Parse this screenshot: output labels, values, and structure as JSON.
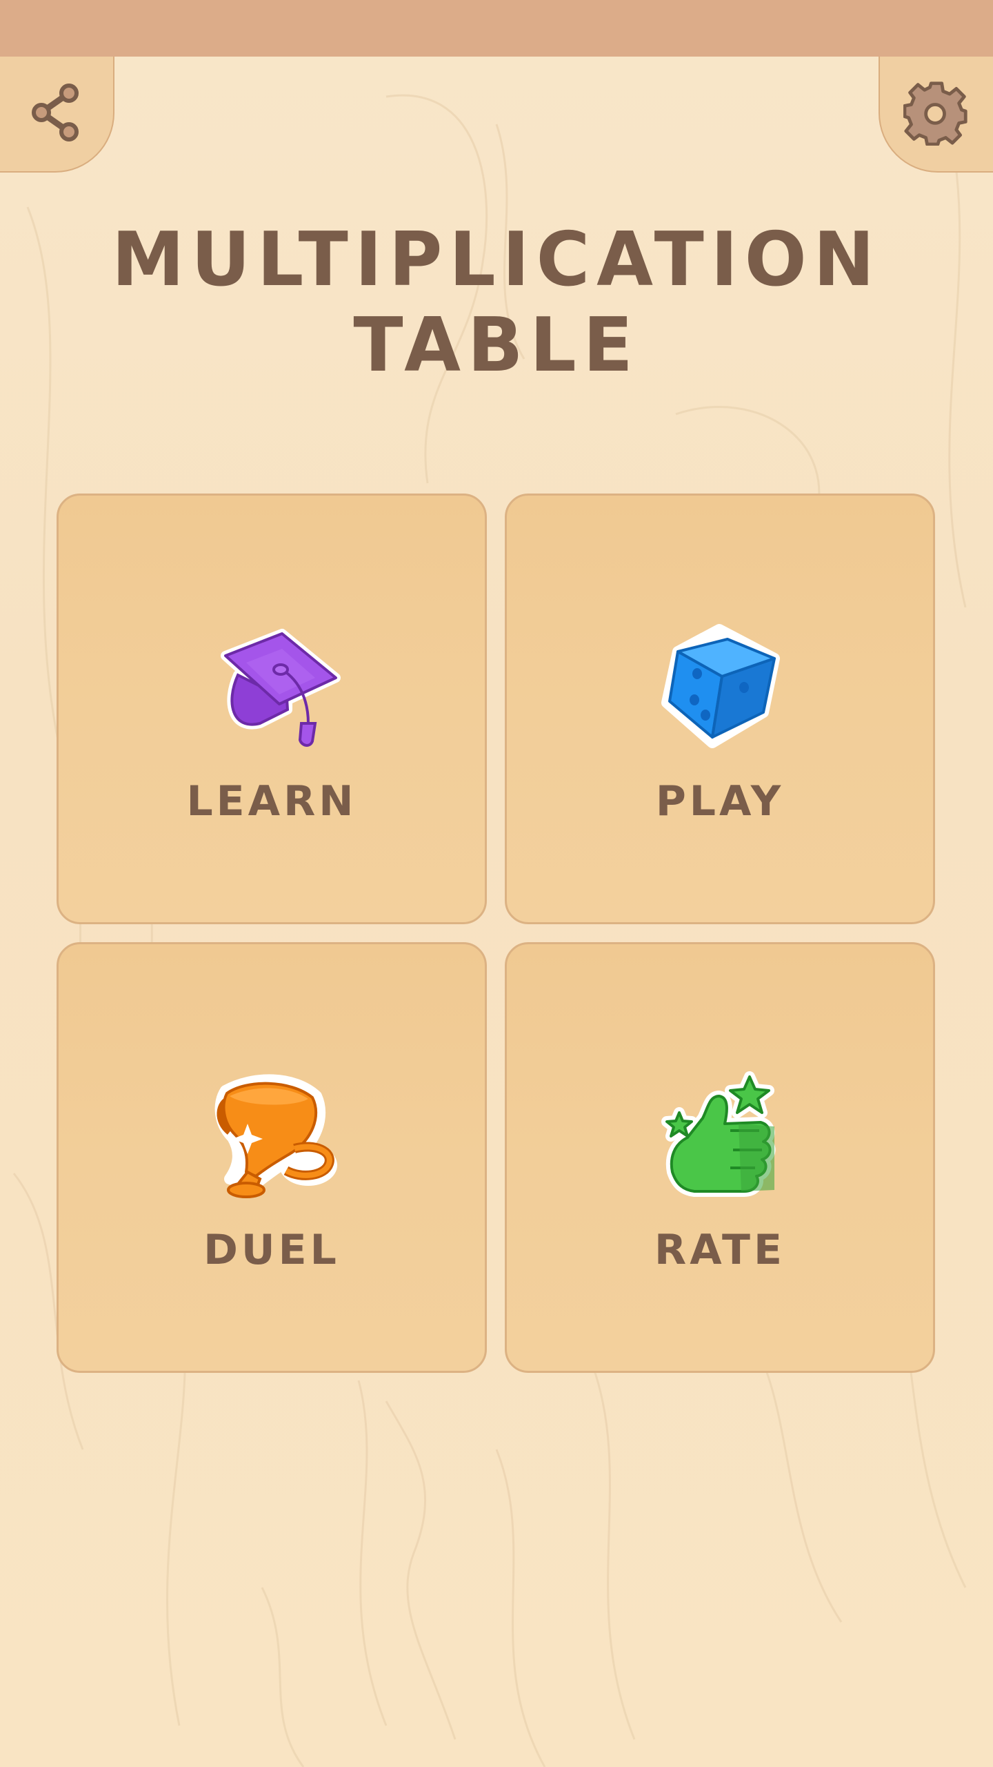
{
  "app": {
    "title_line1": "MULTIPLICATION",
    "title_line2": "TABLE"
  },
  "corners": {
    "share_icon": "share-icon",
    "settings_icon": "gear-icon"
  },
  "menu": [
    {
      "id": "learn",
      "label": "LEARN",
      "icon": "graduation-cap-icon",
      "color": "#9b45e4"
    },
    {
      "id": "play",
      "label": "PLAY",
      "icon": "dice-icon",
      "color": "#2196f3"
    },
    {
      "id": "duel",
      "label": "DUEL",
      "icon": "trophy-icon",
      "color": "#f7870f"
    },
    {
      "id": "rate",
      "label": "RATE",
      "icon": "thumbs-up-icon",
      "color": "#3bb83a"
    }
  ],
  "colors": {
    "background": "#f8e6c9",
    "status_bar": "#dcac89",
    "tile_fill": "#f2cd98",
    "tile_border": "#dcb283",
    "text": "#7a5d4a"
  }
}
